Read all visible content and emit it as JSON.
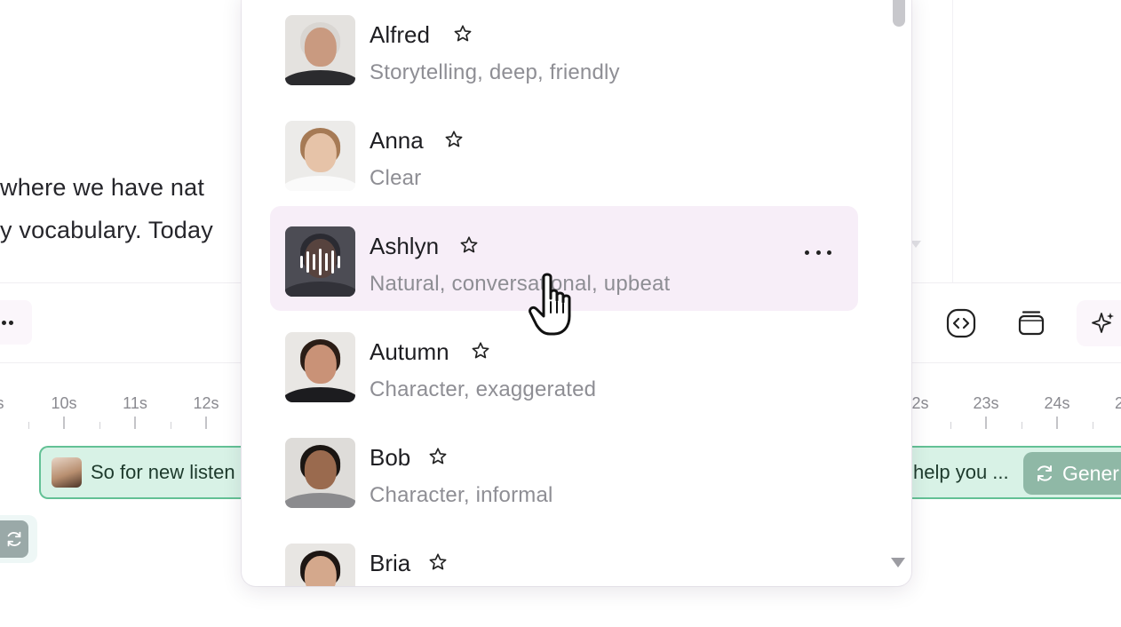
{
  "editor": {
    "script_line_1": "where we have nat",
    "script_line_2": "y vocabulary. Today",
    "timeline_ticks_left": [
      "s",
      "10s",
      "11s",
      "12s"
    ],
    "timeline_ticks_right": [
      "2s",
      "23s",
      "24s",
      "2"
    ],
    "clip_left_text": "So for new listen",
    "clip_right_text": "help you ...",
    "generate_label": "Gener"
  },
  "voices": [
    {
      "name": "Alfred",
      "description": "Storytelling, deep, friendly",
      "active": false
    },
    {
      "name": "Anna",
      "description": "Clear",
      "active": false
    },
    {
      "name": "Ashlyn",
      "description": "Natural, conversational, upbeat",
      "active": true
    },
    {
      "name": "Autumn",
      "description": "Character, exaggerated",
      "active": false
    },
    {
      "name": "Bob",
      "description": "Character, informal",
      "active": false
    },
    {
      "name": "Bria",
      "description": "",
      "active": false
    }
  ],
  "colors": {
    "active_row": "#f7eef8",
    "clip_fill": "#d8f2e6",
    "clip_border": "#63c195",
    "generate_button": "#8fb8a6"
  }
}
